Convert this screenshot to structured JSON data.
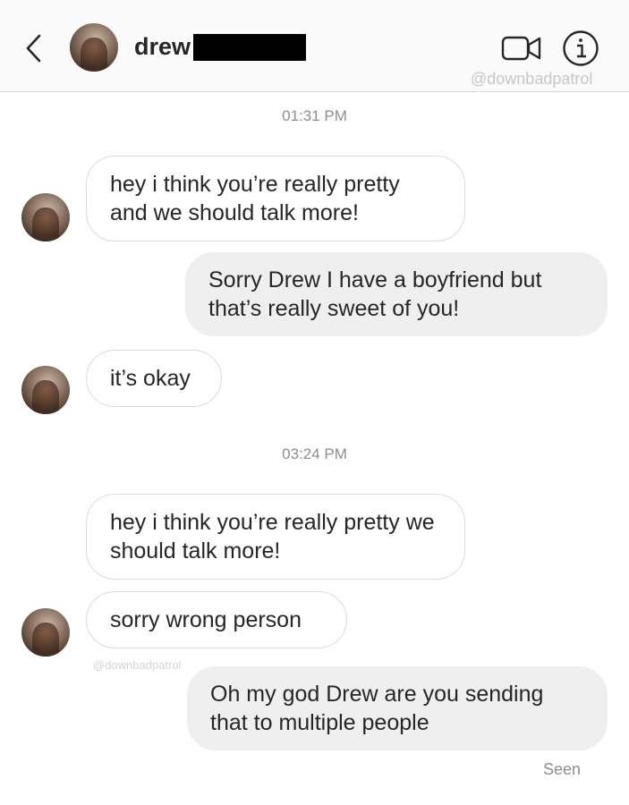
{
  "header": {
    "contact_name": "drew",
    "watermark": "@downbadpatrol"
  },
  "thread": {
    "timestamp_1": "01:31 PM",
    "msg_1": "hey i think you’re really pretty and we should talk more!",
    "msg_2": "Sorry Drew I have a boyfriend but that’s really sweet of you!",
    "msg_3": "it’s okay",
    "timestamp_2": "03:24 PM",
    "msg_4": "hey i think you’re really pretty we should talk more!",
    "msg_5": "sorry wrong person",
    "watermark": "@downbadpatrol",
    "msg_6": "Oh my god Drew are you sending that to multiple people",
    "seen": "Seen"
  },
  "icons": {
    "back": "chevron-left-icon",
    "video": "video-camera-icon",
    "info": "info-icon"
  }
}
